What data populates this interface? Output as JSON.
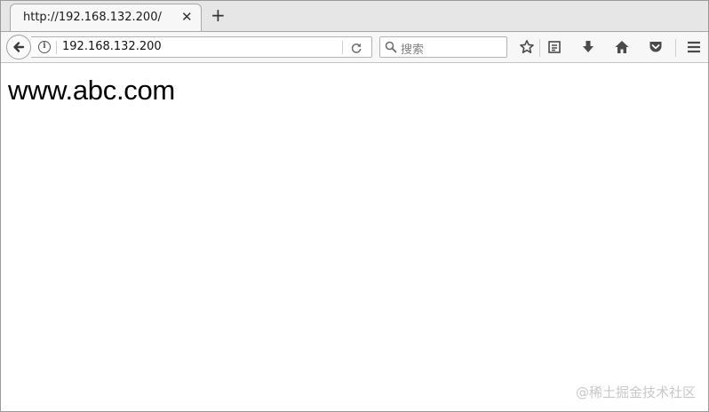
{
  "tab": {
    "title": "http://192.168.132.200/",
    "close_glyph": "✕",
    "new_tab_glyph": "+"
  },
  "navbar": {
    "back_icon": "back-arrow-icon",
    "info_icon": "info-icon",
    "info_glyph": "i",
    "url": "192.168.132.200",
    "reload_icon": "reload-icon",
    "search_placeholder": "搜索",
    "toolbar_icons": [
      "bookmark-star-icon",
      "reader-list-icon",
      "download-icon",
      "home-icon",
      "pocket-icon",
      "menu-icon"
    ]
  },
  "page": {
    "heading": "www.abc.com"
  },
  "watermark": "@稀土掘金技术社区",
  "colors": {
    "tabstrip_bg": "#e6e6e6",
    "toolbar_bg": "#f7f7f7",
    "icon_gray": "#4a4a4a"
  }
}
